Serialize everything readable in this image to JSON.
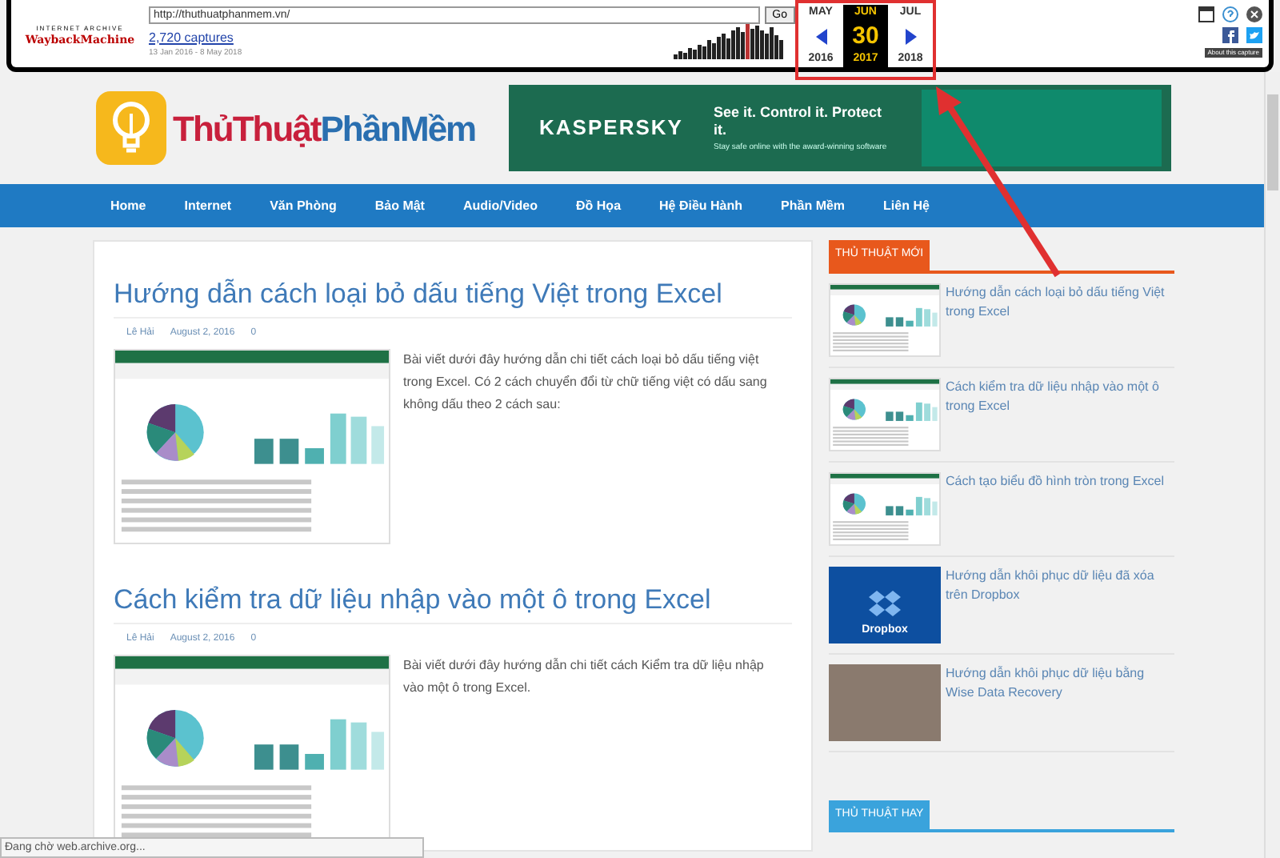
{
  "wayback": {
    "logo_top": "INTERNET ARCHIVE",
    "logo_main": "WaybackMachine",
    "url": "http://thuthuatphanmem.vn/",
    "go": "Go",
    "captures": "2,720 captures",
    "date_range": "13 Jan 2016 - 8 May 2018",
    "months": [
      {
        "label": "MAY",
        "selected": false
      },
      {
        "label": "JUN",
        "selected": true
      },
      {
        "label": "JUL",
        "selected": false
      }
    ],
    "day": "30",
    "years": [
      {
        "label": "2016",
        "selected": false
      },
      {
        "label": "2017",
        "selected": true
      },
      {
        "label": "2018",
        "selected": false
      }
    ],
    "about": "About this capture"
  },
  "site": {
    "logo": {
      "part_1": "ThủThuật",
      "part_2": "PhầnMềm"
    },
    "banner": {
      "brand": "KASPERSKY",
      "headline": "See it. Control it. Protect it.",
      "subtext": "Stay safe online with the award-winning software"
    },
    "nav": [
      "Home",
      "Internet",
      "Văn Phòng",
      "Bảo Mật",
      "Audio/Video",
      "Đồ Họa",
      "Hệ Điều Hành",
      "Phần Mềm",
      "Liên Hệ"
    ],
    "posts": [
      {
        "title": "Hướng dẫn cách loại bỏ dấu tiếng Việt trong Excel",
        "author": "Lê Hải",
        "date": "August 2, 2016",
        "comments": "0",
        "excerpt": "Bài viết dưới đây hướng dẫn chi tiết cách loại bỏ dấu tiếng việt trong Excel. Có 2 cách chuyển đổi từ chữ tiếng việt có dấu sang không dấu theo 2 cách sau:"
      },
      {
        "title": "Cách kiểm tra dữ liệu nhập vào một ô trong Excel",
        "author": "Lê Hải",
        "date": "August 2, 2016",
        "comments": "0",
        "excerpt": "Bài viết dưới đây hướng dẫn chi tiết cách Kiểm tra dữ liệu nhập vào một ô trong Excel."
      }
    ],
    "sidebar": [
      {
        "title": "THỦ THUẬT MỚI",
        "color": "#e8581c",
        "items": [
          {
            "kind": "excel",
            "title": "Hướng dẫn cách loại bỏ dấu tiếng Việt trong Excel"
          },
          {
            "kind": "excel",
            "title": "Cách kiểm tra dữ liệu nhập vào một ô trong Excel"
          },
          {
            "kind": "excel",
            "title": "Cách tạo biểu đồ hình tròn trong Excel"
          },
          {
            "kind": "dropbox",
            "thumb_label": "Dropbox",
            "title": "Hướng dẫn khôi phục dữ liệu đã xóa trên Dropbox"
          },
          {
            "kind": "photo",
            "title": "Hướng dẫn khôi phục dữ liệu bằng Wise Data Recovery"
          }
        ]
      },
      {
        "title": "THỦ THUẬT HAY",
        "color": "#3aa3dc"
      }
    ]
  },
  "status_bar": "Đang chờ web.archive.org..."
}
